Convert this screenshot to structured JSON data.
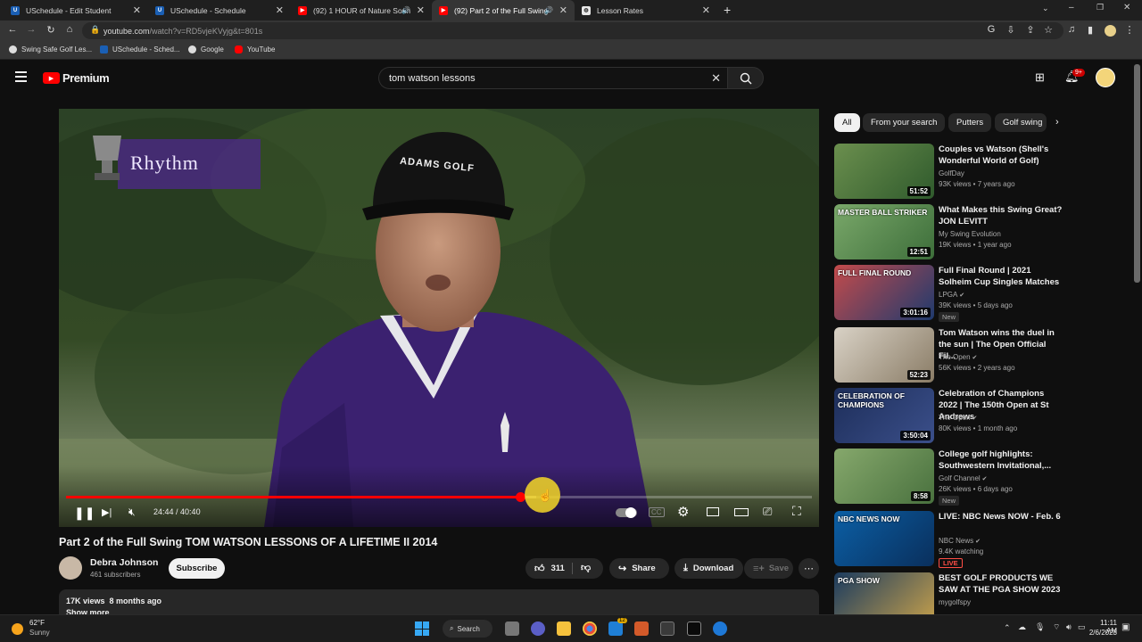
{
  "browser": {
    "tabs": [
      {
        "label": "USchedule - Edit Student",
        "icon": "uschedule-icon",
        "active": false,
        "audio": false
      },
      {
        "label": "USchedule - Schedule",
        "icon": "uschedule-icon",
        "active": false,
        "audio": false
      },
      {
        "label": "(92) 1 HOUR of Nature Soun",
        "icon": "youtube-icon",
        "active": false,
        "audio": true
      },
      {
        "label": "(92) Part 2 of the Full Swing",
        "icon": "youtube-icon",
        "active": true,
        "audio": true
      },
      {
        "label": "Lesson Rates",
        "icon": "globe-icon",
        "active": false,
        "audio": false
      }
    ],
    "url_host": "youtube.com",
    "url_path": "/watch?v=RD5vjeKVyjg&t=801s",
    "bookmarks": [
      {
        "label": "Swing Safe Golf Les...",
        "icon": "globe-icon"
      },
      {
        "label": "USchedule - Sched...",
        "icon": "uschedule-icon"
      },
      {
        "label": "Google",
        "icon": "globe-icon"
      },
      {
        "label": "YouTube",
        "icon": "youtube-icon"
      }
    ]
  },
  "youtube": {
    "logo_text": "Premium",
    "search_value": "tom watson lessons",
    "notification_count": "9+"
  },
  "player": {
    "overlay_text": "Rhythm",
    "cap_text": "ADAMS GOLF",
    "time_current": "24:44",
    "time_total": "40:40",
    "progress": 0.6084,
    "buffered": 0.63
  },
  "video": {
    "title": "Part 2 of the Full Swing TOM WATSON LESSONS OF A LIFETIME II 2014",
    "channel": "Debra Johnson",
    "subscribers": "461 subscribers",
    "subscribe_label": "Subscribe",
    "likes": "311",
    "share_label": "Share",
    "download_label": "Download",
    "save_label": "Save",
    "views": "17K views",
    "age": "8 months ago",
    "show_more": "Show more"
  },
  "chips": [
    "All",
    "From your search",
    "Putters",
    "Golf swing"
  ],
  "related": [
    {
      "title": "Couples vs Watson (Shell's Wonderful World of Golf)",
      "channel": "GolfDay",
      "verified": false,
      "meta": "93K views • 7 years ago",
      "duration": "51:52",
      "badge": "",
      "live": false,
      "thumb_text": "",
      "colors": [
        "#6b8f4e",
        "#2f5a2c"
      ]
    },
    {
      "title": "What Makes this Swing Great? JON LEVITT",
      "channel": "My Swing Evolution",
      "verified": false,
      "meta": "19K views • 1 year ago",
      "duration": "12:51",
      "badge": "",
      "live": false,
      "thumb_text": "MASTER BALL STRIKER",
      "colors": [
        "#7aa86a",
        "#3d6e3a"
      ]
    },
    {
      "title": "Full Final Round | 2021 Solheim Cup Singles Matches",
      "channel": "LPGA",
      "verified": true,
      "meta": "39K views • 5 days ago",
      "duration": "3:01:16",
      "badge": "New",
      "live": false,
      "thumb_text": "FULL FINAL ROUND",
      "colors": [
        "#c44b4b",
        "#1e3a6e"
      ]
    },
    {
      "title": "Tom Watson wins the duel in the sun | The Open Official Fil...",
      "channel": "The Open",
      "verified": true,
      "meta": "56K views • 2 years ago",
      "duration": "52:23",
      "badge": "",
      "live": false,
      "thumb_text": "",
      "colors": [
        "#d9d2c6",
        "#8a7c66"
      ]
    },
    {
      "title": "Celebration of Champions 2022 | The 150th Open at St Andrews",
      "channel": "The Open",
      "verified": true,
      "meta": "80K views • 1 month ago",
      "duration": "3:50:04",
      "badge": "",
      "live": false,
      "thumb_text": "CELEBRATION OF CHAMPIONS",
      "colors": [
        "#1d2e5a",
        "#3b4f8a"
      ]
    },
    {
      "title": "College golf highlights: Southwestern Invitational,...",
      "channel": "Golf Channel",
      "verified": true,
      "meta": "26K views • 6 days ago",
      "duration": "8:58",
      "badge": "New",
      "live": false,
      "thumb_text": "",
      "colors": [
        "#86a86c",
        "#49713e"
      ]
    },
    {
      "title": "LIVE: NBC News NOW - Feb. 6",
      "channel": "NBC News",
      "verified": true,
      "meta": "9.4K watching",
      "duration": "",
      "badge": "",
      "live": true,
      "thumb_text": "NBC NEWS NOW",
      "colors": [
        "#0b5fa5",
        "#0a2f5c"
      ]
    },
    {
      "title": "BEST GOLF PRODUCTS WE SAW AT THE PGA SHOW 2023",
      "channel": "mygolfspy",
      "verified": false,
      "meta": "",
      "duration": "",
      "badge": "",
      "live": false,
      "thumb_text": "PGA SHOW",
      "colors": [
        "#1b3b5f",
        "#c9a24b"
      ]
    }
  ],
  "live_label": "LIVE",
  "taskbar": {
    "weather_temp": "62°F",
    "weather_desc": "Sunny",
    "search_label": "Search",
    "mail_badge": "12",
    "time": "11:11 AM",
    "date": "2/6/2023"
  }
}
